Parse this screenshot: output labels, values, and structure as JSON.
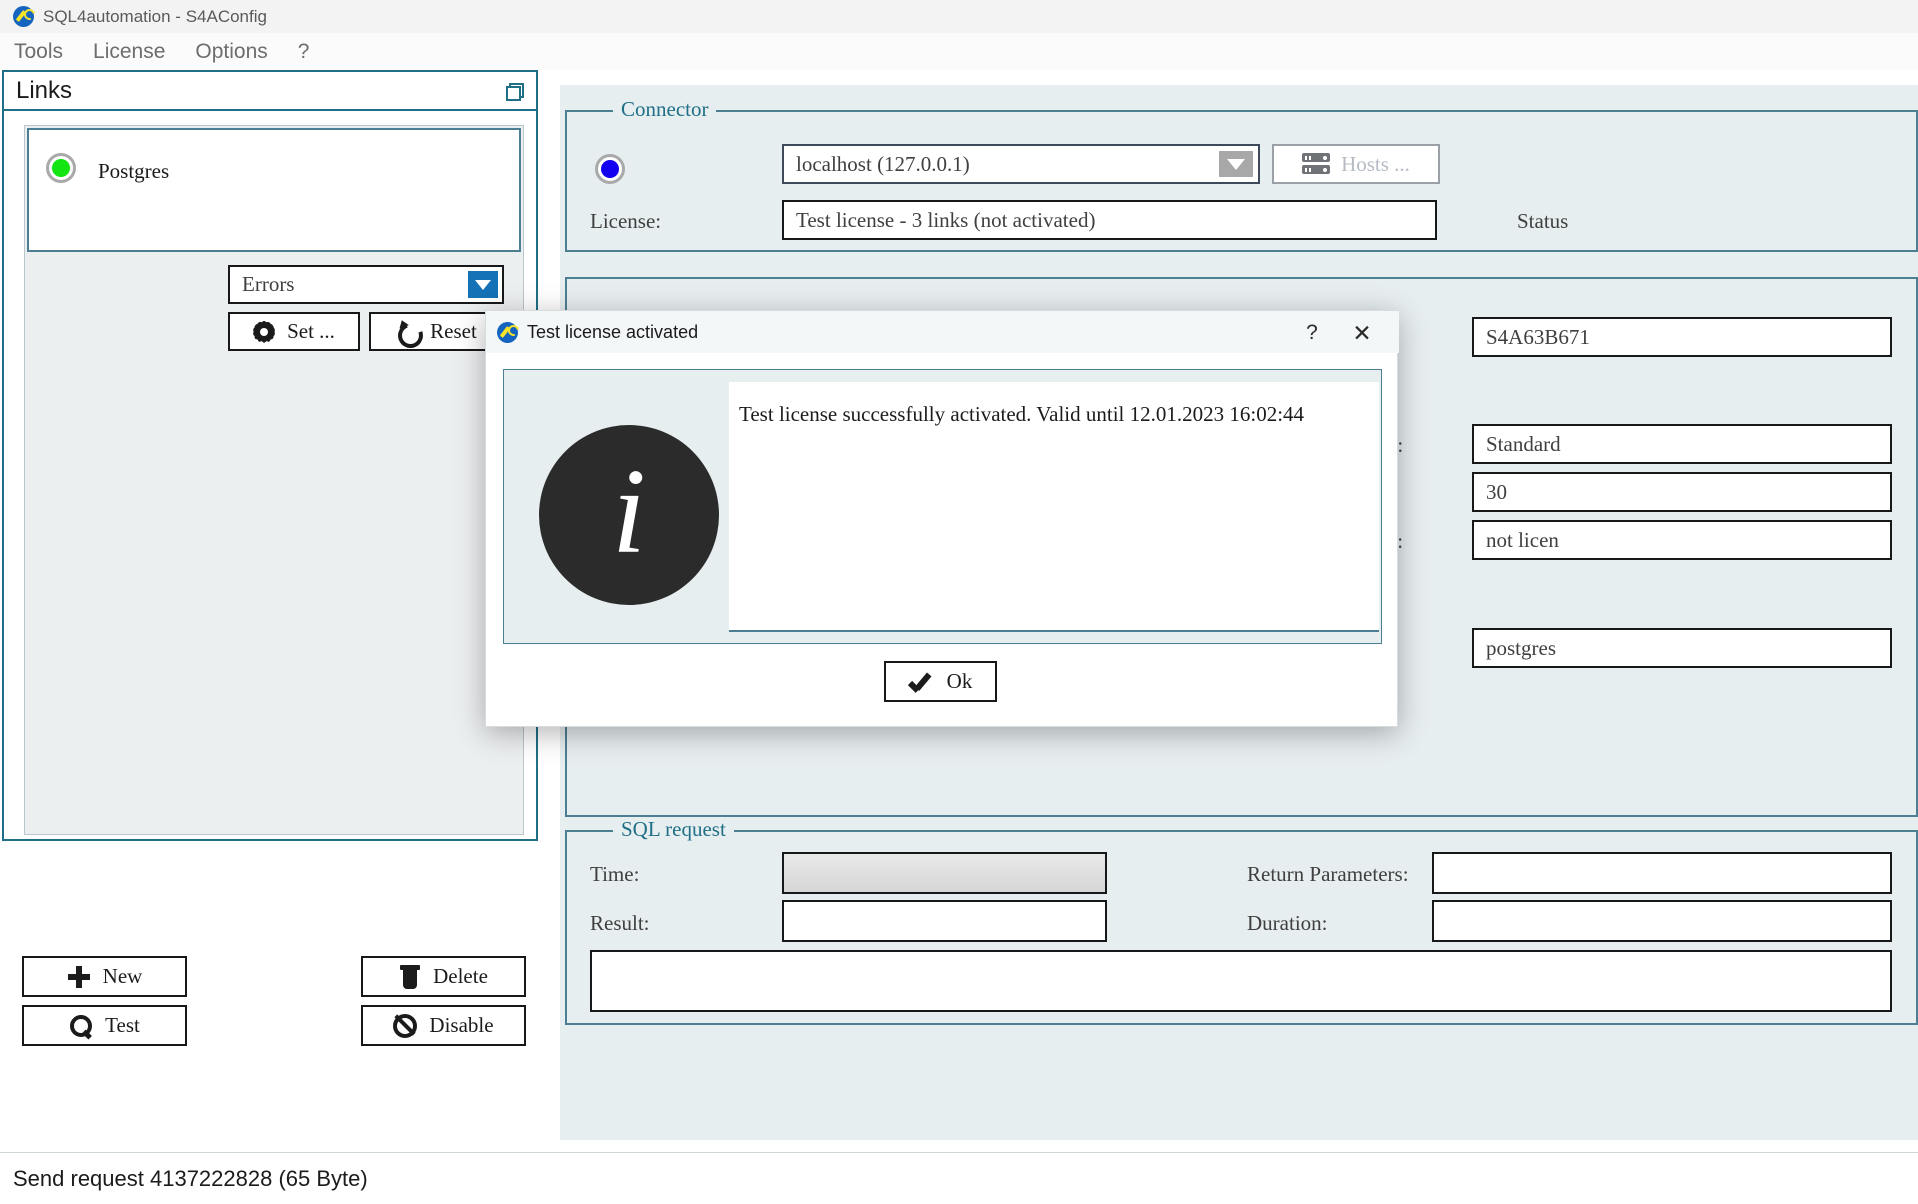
{
  "window": {
    "title": "SQL4automation - S4AConfig",
    "icon": "wrench-icon"
  },
  "menubar": {
    "items": [
      {
        "label": "Tools"
      },
      {
        "label": "License"
      },
      {
        "label": "Options"
      },
      {
        "label": "?"
      }
    ]
  },
  "links_panel": {
    "title": "Links",
    "restore_icon": "restore-window-icon",
    "link": {
      "led_color": "#12e512",
      "name": "Postgres",
      "combo_value": "Errors",
      "set_button": "Set ...",
      "reset_button": "Reset",
      "set_icon": "gear-icon",
      "reset_icon": "refresh-icon"
    },
    "buttons": {
      "new": "New",
      "test": "Test",
      "delete": "Delete",
      "disable": "Disable",
      "new_icon": "plus-icon",
      "test_icon": "magnifier-icon",
      "delete_icon": "trash-icon",
      "disable_icon": "prohibition-icon"
    }
  },
  "connector": {
    "legend": "Connector",
    "led_color": "#1400f0",
    "host": "localhost (127.0.0.1)",
    "hosts_button": "Hosts ...",
    "hosts_icon": "server-rack-icon",
    "license_label": "License:",
    "license_value": "Test license - 3 links (not activated)",
    "status_label": "Status"
  },
  "link_details": {
    "key_value": "S4A63B671",
    "type_label": "ype:",
    "type_value": "Standard",
    "timeout_value": "30",
    "state_label": "tate:",
    "state_value": "not licen",
    "database_value": "postgres"
  },
  "sql_request": {
    "legend": "SQL request",
    "time_label": "Time:",
    "time_value": "",
    "result_label": "Result:",
    "result_value": "",
    "return_parameters_label": "Return Parameters:",
    "return_parameters_value": "",
    "duration_label": "Duration:",
    "duration_value": "",
    "output_value": ""
  },
  "dialog": {
    "title": "Test license activated",
    "icon": "wrench-icon",
    "help_label": "?",
    "close_label": "✕",
    "info_icon": "info-icon",
    "info_glyph": "i",
    "message": "Test license successfully activated. Valid until 12.01.2023 16:02:44",
    "ok_label": "Ok",
    "ok_icon": "check-icon"
  },
  "statusbar": {
    "text": "Send request 4137222828 (65 Byte)"
  }
}
